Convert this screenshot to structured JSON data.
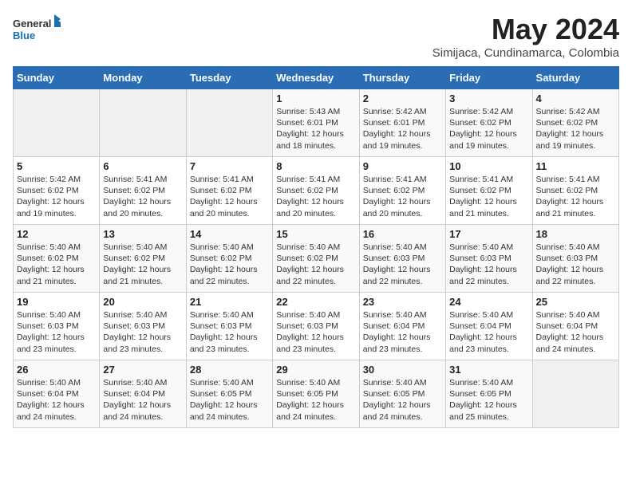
{
  "header": {
    "logo_general": "General",
    "logo_blue": "Blue",
    "month_year": "May 2024",
    "location": "Simijaca, Cundinamarca, Colombia"
  },
  "days_of_week": [
    "Sunday",
    "Monday",
    "Tuesday",
    "Wednesday",
    "Thursday",
    "Friday",
    "Saturday"
  ],
  "weeks": [
    [
      {
        "day": "",
        "info": ""
      },
      {
        "day": "",
        "info": ""
      },
      {
        "day": "",
        "info": ""
      },
      {
        "day": "1",
        "info": "Sunrise: 5:43 AM\nSunset: 6:01 PM\nDaylight: 12 hours\nand 18 minutes."
      },
      {
        "day": "2",
        "info": "Sunrise: 5:42 AM\nSunset: 6:01 PM\nDaylight: 12 hours\nand 19 minutes."
      },
      {
        "day": "3",
        "info": "Sunrise: 5:42 AM\nSunset: 6:02 PM\nDaylight: 12 hours\nand 19 minutes."
      },
      {
        "day": "4",
        "info": "Sunrise: 5:42 AM\nSunset: 6:02 PM\nDaylight: 12 hours\nand 19 minutes."
      }
    ],
    [
      {
        "day": "5",
        "info": "Sunrise: 5:42 AM\nSunset: 6:02 PM\nDaylight: 12 hours\nand 19 minutes."
      },
      {
        "day": "6",
        "info": "Sunrise: 5:41 AM\nSunset: 6:02 PM\nDaylight: 12 hours\nand 20 minutes."
      },
      {
        "day": "7",
        "info": "Sunrise: 5:41 AM\nSunset: 6:02 PM\nDaylight: 12 hours\nand 20 minutes."
      },
      {
        "day": "8",
        "info": "Sunrise: 5:41 AM\nSunset: 6:02 PM\nDaylight: 12 hours\nand 20 minutes."
      },
      {
        "day": "9",
        "info": "Sunrise: 5:41 AM\nSunset: 6:02 PM\nDaylight: 12 hours\nand 20 minutes."
      },
      {
        "day": "10",
        "info": "Sunrise: 5:41 AM\nSunset: 6:02 PM\nDaylight: 12 hours\nand 21 minutes."
      },
      {
        "day": "11",
        "info": "Sunrise: 5:41 AM\nSunset: 6:02 PM\nDaylight: 12 hours\nand 21 minutes."
      }
    ],
    [
      {
        "day": "12",
        "info": "Sunrise: 5:40 AM\nSunset: 6:02 PM\nDaylight: 12 hours\nand 21 minutes."
      },
      {
        "day": "13",
        "info": "Sunrise: 5:40 AM\nSunset: 6:02 PM\nDaylight: 12 hours\nand 21 minutes."
      },
      {
        "day": "14",
        "info": "Sunrise: 5:40 AM\nSunset: 6:02 PM\nDaylight: 12 hours\nand 22 minutes."
      },
      {
        "day": "15",
        "info": "Sunrise: 5:40 AM\nSunset: 6:02 PM\nDaylight: 12 hours\nand 22 minutes."
      },
      {
        "day": "16",
        "info": "Sunrise: 5:40 AM\nSunset: 6:03 PM\nDaylight: 12 hours\nand 22 minutes."
      },
      {
        "day": "17",
        "info": "Sunrise: 5:40 AM\nSunset: 6:03 PM\nDaylight: 12 hours\nand 22 minutes."
      },
      {
        "day": "18",
        "info": "Sunrise: 5:40 AM\nSunset: 6:03 PM\nDaylight: 12 hours\nand 22 minutes."
      }
    ],
    [
      {
        "day": "19",
        "info": "Sunrise: 5:40 AM\nSunset: 6:03 PM\nDaylight: 12 hours\nand 23 minutes."
      },
      {
        "day": "20",
        "info": "Sunrise: 5:40 AM\nSunset: 6:03 PM\nDaylight: 12 hours\nand 23 minutes."
      },
      {
        "day": "21",
        "info": "Sunrise: 5:40 AM\nSunset: 6:03 PM\nDaylight: 12 hours\nand 23 minutes."
      },
      {
        "day": "22",
        "info": "Sunrise: 5:40 AM\nSunset: 6:03 PM\nDaylight: 12 hours\nand 23 minutes."
      },
      {
        "day": "23",
        "info": "Sunrise: 5:40 AM\nSunset: 6:04 PM\nDaylight: 12 hours\nand 23 minutes."
      },
      {
        "day": "24",
        "info": "Sunrise: 5:40 AM\nSunset: 6:04 PM\nDaylight: 12 hours\nand 23 minutes."
      },
      {
        "day": "25",
        "info": "Sunrise: 5:40 AM\nSunset: 6:04 PM\nDaylight: 12 hours\nand 24 minutes."
      }
    ],
    [
      {
        "day": "26",
        "info": "Sunrise: 5:40 AM\nSunset: 6:04 PM\nDaylight: 12 hours\nand 24 minutes."
      },
      {
        "day": "27",
        "info": "Sunrise: 5:40 AM\nSunset: 6:04 PM\nDaylight: 12 hours\nand 24 minutes."
      },
      {
        "day": "28",
        "info": "Sunrise: 5:40 AM\nSunset: 6:05 PM\nDaylight: 12 hours\nand 24 minutes."
      },
      {
        "day": "29",
        "info": "Sunrise: 5:40 AM\nSunset: 6:05 PM\nDaylight: 12 hours\nand 24 minutes."
      },
      {
        "day": "30",
        "info": "Sunrise: 5:40 AM\nSunset: 6:05 PM\nDaylight: 12 hours\nand 24 minutes."
      },
      {
        "day": "31",
        "info": "Sunrise: 5:40 AM\nSunset: 6:05 PM\nDaylight: 12 hours\nand 25 minutes."
      },
      {
        "day": "",
        "info": ""
      }
    ]
  ]
}
